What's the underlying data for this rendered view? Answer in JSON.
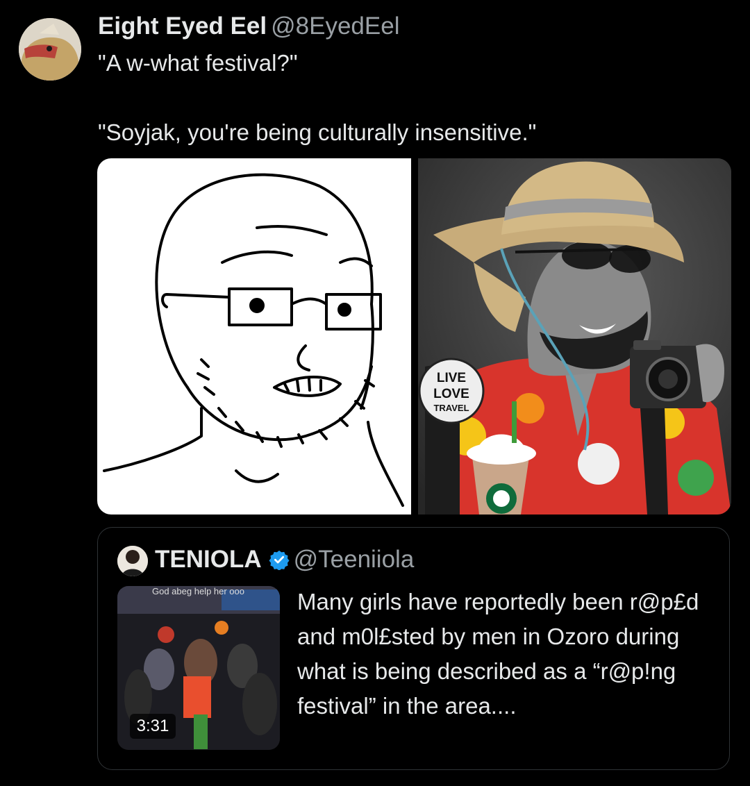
{
  "tweet": {
    "author_name": "Eight Eyed Eel",
    "author_handle": "@8EyedEel",
    "line1": "\"A w-what festival?\"",
    "line2": "\"Soyjak, you're being culturally insensitive.\""
  },
  "media": {
    "left_image": "soyjak-drawing",
    "right_image": "gigachad-tourist-photo",
    "badge_text": [
      "LIVE",
      "LOVE",
      "TRAVEL"
    ]
  },
  "quoted_tweet": {
    "author_name": "TENIOLA",
    "author_handle": "@Teeniiola",
    "verified_icon": "verified-badge-icon",
    "thumbnail_caption": "God abeg help her ooo",
    "video_duration": "3:31",
    "text": "Many girls have reportedly been r@p£d and m0l£sted by men in Ozoro during what is being described as a “r@p!ng festival” in the area...."
  },
  "colors": {
    "background": "#000000",
    "text": "#e7e9ea",
    "secondary_text": "#9aa0a5",
    "border": "#2f3336",
    "verified": "#1d9bf0"
  }
}
